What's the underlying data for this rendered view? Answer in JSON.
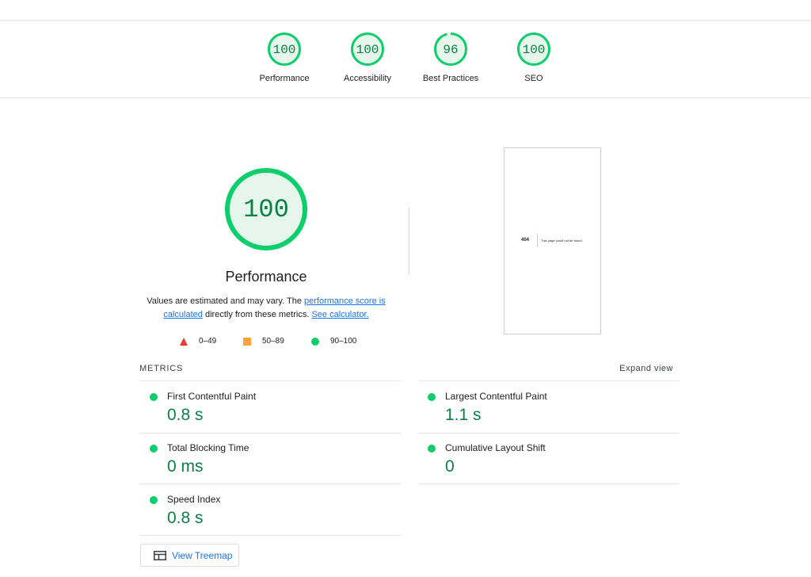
{
  "header": {
    "gauges": [
      {
        "score": "100",
        "value": 100,
        "label": "Performance"
      },
      {
        "score": "100",
        "value": 100,
        "label": "Accessibility"
      },
      {
        "score": "96",
        "value": 96,
        "label": "Best Practices"
      },
      {
        "score": "100",
        "value": 100,
        "label": "SEO"
      }
    ]
  },
  "performance": {
    "score": "100",
    "value": 100,
    "title": "Performance",
    "desc_prefix": "Values are estimated and may vary. The ",
    "desc_link": "performance score is calculated",
    "desc_middle": " directly from these metrics. ",
    "calc_link": "See calculator."
  },
  "legend": {
    "fail": "0–49",
    "average": "50–89",
    "pass": "90–100"
  },
  "screenshot": {
    "code": "404",
    "message": "This page could not be found."
  },
  "metrics": {
    "title": "METRICS",
    "expand_label": "Expand view",
    "items": [
      {
        "name": "First Contentful Paint",
        "value": "0.8 s"
      },
      {
        "name": "Largest Contentful Paint",
        "value": "1.1 s"
      },
      {
        "name": "Total Blocking Time",
        "value": "0 ms"
      },
      {
        "name": "Cumulative Layout Shift",
        "value": "0"
      },
      {
        "name": "Speed Index",
        "value": "0.8 s"
      }
    ]
  },
  "treemap": {
    "label": "View Treemap"
  },
  "colors": {
    "pass": "#0cce6b",
    "pass_text": "#0b8043",
    "pass_fill": "#e6f6ec",
    "average": "#ffa33a",
    "fail": "#eb3a2f",
    "link": "#1a73e8"
  }
}
